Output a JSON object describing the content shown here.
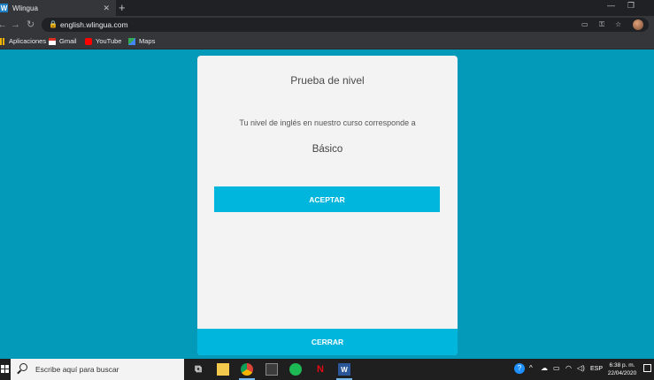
{
  "browser": {
    "tab_title": "Wlingua",
    "tab_favicon_letter": "W",
    "url": "english.wlingua.com",
    "bookmarks": [
      {
        "label": "Aplicaciones",
        "icon": "apps-grid-icon"
      },
      {
        "label": "Gmail",
        "icon": "gmail-icon"
      },
      {
        "label": "YouTube",
        "icon": "youtube-icon"
      },
      {
        "label": "Maps",
        "icon": "maps-icon"
      }
    ]
  },
  "modal": {
    "title": "Prueba de nivel",
    "result_text": "Tu nivel de inglés en nuestro curso corresponde a",
    "level": "Básico",
    "accept_label": "ACEPTAR",
    "close_label": "CERRAR"
  },
  "taskbar": {
    "search_placeholder": "Escribe aquí para buscar",
    "language": "ESP",
    "time": "6:38 p. m.",
    "date": "22/04/2020"
  },
  "colors": {
    "page_background": "#0399b8",
    "button": "#00b6dc",
    "card": "#f3f3f3"
  }
}
